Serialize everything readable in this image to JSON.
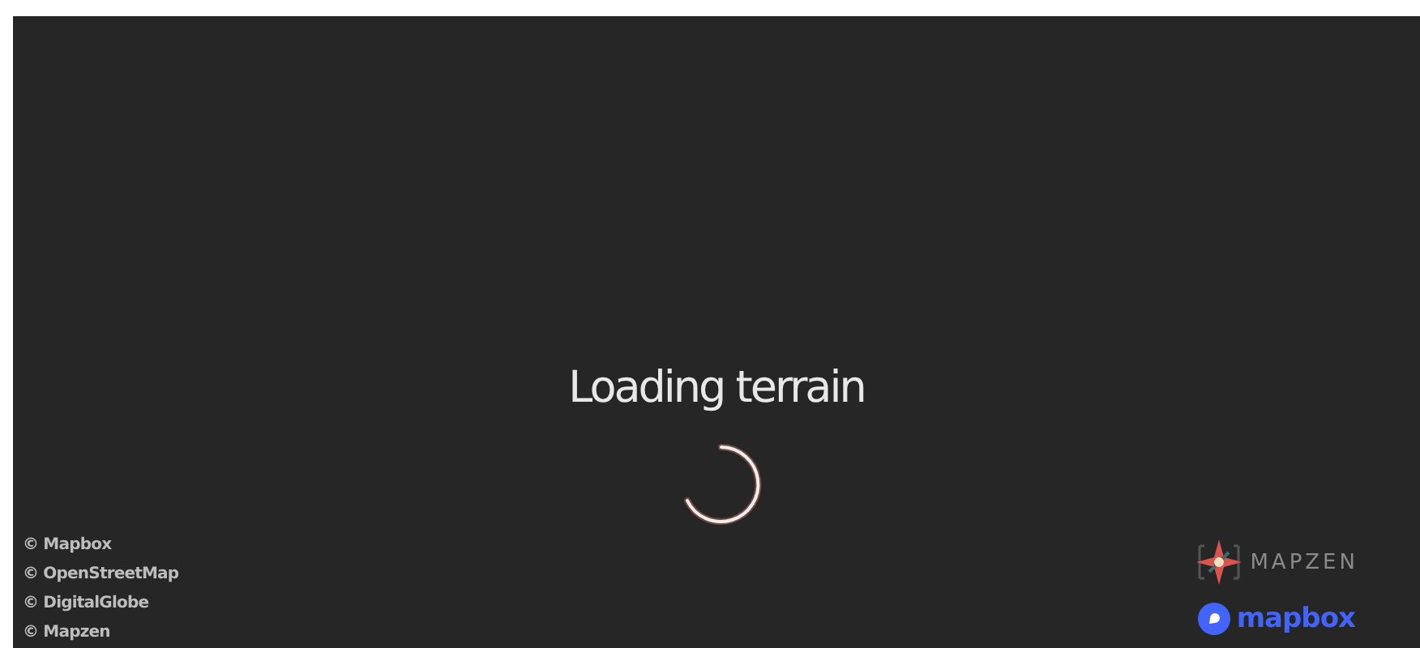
{
  "loading": {
    "message": "Loading terrain"
  },
  "attributions": [
    "© Mapbox",
    "© OpenStreetMap",
    "© DigitalGlobe",
    "© Mapzen"
  ],
  "logos": [
    {
      "kind": "mapzen",
      "label": "MAPZEN"
    },
    {
      "kind": "mapbox",
      "label": "mapbox"
    }
  ]
}
